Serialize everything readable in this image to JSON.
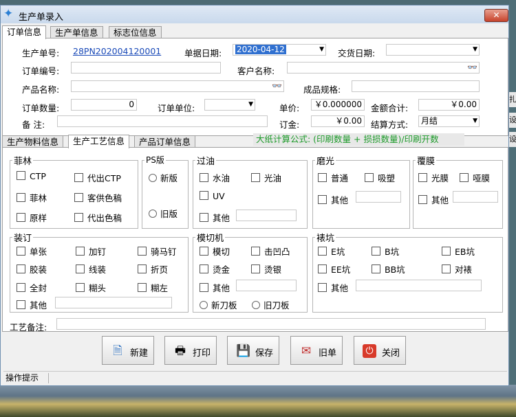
{
  "window": {
    "title": "生产单录入",
    "close_symbol": "✕"
  },
  "top_tabs": [
    "订单信息",
    "生产单信息",
    "标志位信息"
  ],
  "order": {
    "prod_no_label": "生产单号:",
    "prod_no_value": "28PN202004120001",
    "doc_date_label": "单据日期:",
    "doc_date_value": "2020-04-12",
    "delivery_label": "交货日期:",
    "delivery_value": "",
    "order_no_label": "订单编号:",
    "order_no_value": "",
    "customer_label": "客户名称:",
    "customer_value": "",
    "product_label": "产品名称:",
    "product_value": "",
    "spec_label": "成品规格:",
    "spec_value": "",
    "qty_label": "订单数量:",
    "qty_value": "0",
    "unit_label": "订单单位:",
    "unit_value": "",
    "price_label": "单价:",
    "price_value": "￥0.000000",
    "total_label": "金额合计:",
    "total_value": "￥0.00",
    "remark_label": "备  注:",
    "remark_value": "",
    "deposit_label": "订金:",
    "deposit_value": "￥0.00",
    "settle_label": "结算方式:",
    "settle_value": "月结"
  },
  "sub_tabs": [
    "生产物料信息",
    "生产工艺信息",
    "产品订单信息"
  ],
  "formula": "大纸计算公式: (印刷数量 + 损损数量)/印刷开数",
  "groups": {
    "feilin": {
      "title": "菲林",
      "items": [
        "CTP",
        "代出CTP",
        "菲林",
        "客供色稿",
        "原样",
        "代出色稿"
      ]
    },
    "ps": {
      "title": "PS版",
      "radios": [
        "新版",
        "旧版"
      ]
    },
    "guoyou": {
      "title": "过油",
      "items": [
        "水油",
        "光油",
        "UV",
        "其他"
      ]
    },
    "moguang": {
      "title": "磨光",
      "items": [
        "普通",
        "吸塑",
        "其他"
      ]
    },
    "fumo": {
      "title": "覆膜",
      "items": [
        "光膜",
        "哑膜",
        "其他"
      ]
    },
    "zhuangding": {
      "title": "装订",
      "items": [
        "单张",
        "加钉",
        "骑马钉",
        "胶装",
        "线装",
        "折页",
        "全封",
        "糊头",
        "糊左",
        "其他"
      ]
    },
    "moqie": {
      "title": "模切机",
      "items": [
        "模切",
        "击凹凸",
        "烫金",
        "烫银",
        "其他"
      ],
      "radios": [
        "新刀板",
        "旧刀板"
      ]
    },
    "biaokang": {
      "title": "裱坑",
      "items": [
        "E坑",
        "B坑",
        "EB坑",
        "EE坑",
        "BB坑",
        "对裱",
        "其他"
      ]
    }
  },
  "craft_remark_label": "工艺备注:",
  "buttons": {
    "new": "新建",
    "print": "打印",
    "save": "保存",
    "old": "旧单",
    "close": "关闭"
  },
  "status": {
    "hint": "操作提示"
  },
  "peek": {
    "a": "扎",
    "b": "设",
    "c": "设"
  }
}
